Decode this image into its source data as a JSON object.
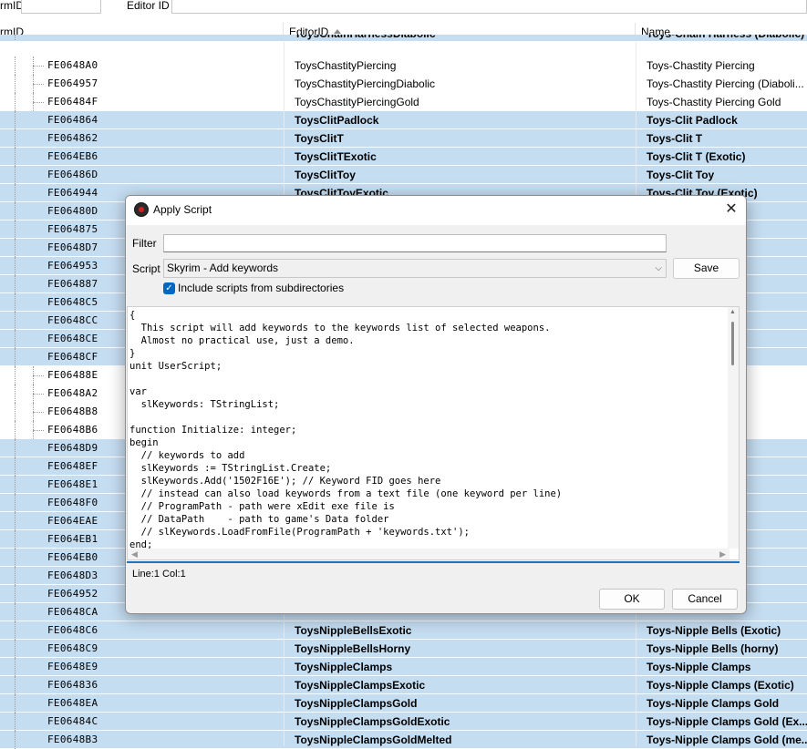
{
  "filter_bar": {
    "formid_label": "rmID",
    "editorid_label": "Editor ID"
  },
  "columns": {
    "formid": "rmID",
    "editorid": "EditorID",
    "name": "Name"
  },
  "rows": [
    {
      "id": "",
      "editor": "ToysChainHarnessDiabolic",
      "name": "Toys-Chain Harness (Diabolic)",
      "sel": true,
      "partial": true
    },
    {
      "id": "FE0648A0",
      "editor": "ToysChastityPiercing",
      "name": "Toys-Chastity Piercing",
      "sel": false
    },
    {
      "id": "FE064957",
      "editor": "ToysChastityPiercingDiabolic",
      "name": "Toys-Chastity Piercing (Diaboli...",
      "sel": false
    },
    {
      "id": "FE06484F",
      "editor": "ToysChastityPiercingGold",
      "name": "Toys-Chastity Piercing Gold",
      "sel": false
    },
    {
      "id": "FE064864",
      "editor": "ToysClitPadlock",
      "name": "Toys-Clit Padlock",
      "sel": true
    },
    {
      "id": "FE064862",
      "editor": "ToysClitT",
      "name": "Toys-Clit T",
      "sel": true
    },
    {
      "id": "FE064EB6",
      "editor": "ToysClitTExotic",
      "name": "Toys-Clit T (Exotic)",
      "sel": true
    },
    {
      "id": "FE06486D",
      "editor": "ToysClitToy",
      "name": "Toys-Clit Toy",
      "sel": true
    },
    {
      "id": "FE064944",
      "editor": "ToysClitToyExotic",
      "name": "Toys-Clit Toy (Exotic)",
      "sel": true
    },
    {
      "id": "FE06480D",
      "editor": "",
      "name": "",
      "sel": true
    },
    {
      "id": "FE064875",
      "editor": "",
      "name": "xotic)",
      "sel": true
    },
    {
      "id": "FE0648D7",
      "editor": "",
      "name": "ollar",
      "sel": true
    },
    {
      "id": "FE064953",
      "editor": "",
      "name": "ollar (My...",
      "sel": true
    },
    {
      "id": "FE064887",
      "editor": "",
      "name": "ers",
      "sel": true
    },
    {
      "id": "FE0648C5",
      "editor": "",
      "name": "ers (Myst...",
      "sel": true
    },
    {
      "id": "FE0648CC",
      "editor": "",
      "name": "",
      "sel": true
    },
    {
      "id": "FE0648CE",
      "editor": "",
      "name": "xotic)",
      "sel": true
    },
    {
      "id": "FE0648CF",
      "editor": "",
      "name": "elted)",
      "sel": true
    },
    {
      "id": "FE06488E",
      "editor": "",
      "name": "s",
      "sel": false
    },
    {
      "id": "FE0648A2",
      "editor": "",
      "name": "",
      "sel": false
    },
    {
      "id": "FE0648B8",
      "editor": "",
      "name": "ken)",
      "sel": false
    },
    {
      "id": "FE0648B6",
      "editor": "",
      "name": "tic)",
      "sel": false
    },
    {
      "id": "FE0648D9",
      "editor": "",
      "name": "",
      "sel": true
    },
    {
      "id": "FE0648EF",
      "editor": "",
      "name": "xotic)",
      "sel": true
    },
    {
      "id": "FE0648E1",
      "editor": "",
      "name": "old",
      "sel": true
    },
    {
      "id": "FE0648F0",
      "editor": "",
      "name": "old (Exot...",
      "sel": true
    },
    {
      "id": "FE064EAE",
      "editor": "",
      "name": "",
      "sel": true
    },
    {
      "id": "FE064EB1",
      "editor": "",
      "name": "c)",
      "sel": true
    },
    {
      "id": "FE064EB0",
      "editor": "",
      "name": "ed)",
      "sel": true
    },
    {
      "id": "FE0648D3",
      "editor": "",
      "name": "",
      "sel": true
    },
    {
      "id": "FE064952",
      "editor": "",
      "name": "tic)",
      "sel": true
    },
    {
      "id": "FE0648CA",
      "editor": "",
      "name": "",
      "sel": true
    },
    {
      "id": "FE0648C6",
      "editor": "ToysNippleBellsExotic",
      "name": "Toys-Nipple Bells (Exotic)",
      "sel": true
    },
    {
      "id": "FE0648C9",
      "editor": "ToysNippleBellsHorny",
      "name": "Toys-Nipple Bells (horny)",
      "sel": true
    },
    {
      "id": "FE0648E9",
      "editor": "ToysNippleClamps",
      "name": "Toys-Nipple Clamps",
      "sel": true
    },
    {
      "id": "FE064836",
      "editor": "ToysNippleClampsExotic",
      "name": "Toys-Nipple Clamps (Exotic)",
      "sel": true
    },
    {
      "id": "FE0648EA",
      "editor": "ToysNippleClampsGold",
      "name": "Toys-Nipple Clamps Gold",
      "sel": true
    },
    {
      "id": "FE06484C",
      "editor": "ToysNippleClampsGoldExotic",
      "name": "Toys-Nipple Clamps Gold (Ex...",
      "sel": true
    },
    {
      "id": "FE0648B3",
      "editor": "ToysNippleClampsGoldMelted",
      "name": "Toys-Nipple Clamps Gold (me...",
      "sel": true
    }
  ],
  "dialog": {
    "title": "Apply Script",
    "filter_label": "Filter",
    "filter_value": "",
    "script_label": "Script",
    "script_value": "Skyrim - Add keywords",
    "save_label": "Save",
    "include_subdirs_label": "Include scripts from subdirectories",
    "include_subdirs_checked": true,
    "code": "{\n  This script will add keywords to the keywords list of selected weapons.\n  Almost no practical use, just a demo.\n}\nunit UserScript;\n\nvar\n  slKeywords: TStringList;\n\nfunction Initialize: integer;\nbegin\n  // keywords to add\n  slKeywords := TStringList.Create;\n  slKeywords.Add('1502F16E'); // Keyword FID goes here\n  // instead can also load keywords from a text file (one keyword per line)\n  // ProgramPath - path were xEdit exe file is\n  // DataPath    - path to game's Data folder\n  // slKeywords.LoadFromFile(ProgramPath + 'keywords.txt');\nend;",
    "status": "Line:1 Col:1",
    "ok_label": "OK",
    "cancel_label": "Cancel"
  },
  "colors": {
    "selection": "#c5ddf1",
    "accent": "#0067c0",
    "status_line": "#1e73be"
  }
}
